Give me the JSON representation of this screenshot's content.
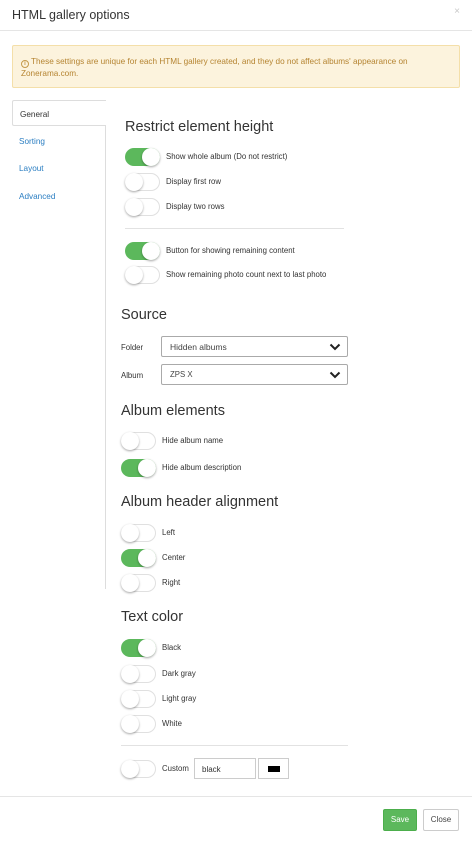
{
  "dialog": {
    "title": "HTML gallery options",
    "close_glyph": "×"
  },
  "alert": {
    "icon": "info-icon",
    "icon_glyph": "i",
    "text": "These settings are unique for each HTML gallery created, and they do not affect albums' appearance on Zonerama.com."
  },
  "tabs": [
    {
      "label": "General",
      "active": true
    },
    {
      "label": "Sorting",
      "active": false
    },
    {
      "label": "Layout",
      "active": false
    },
    {
      "label": "Advanced",
      "active": false
    }
  ],
  "restrict": {
    "title": "Restrict element height",
    "options": [
      {
        "label": "Show whole album (Do not restrict)",
        "on": true
      },
      {
        "label": "Display first row",
        "on": false
      },
      {
        "label": "Display two rows",
        "on": false
      }
    ],
    "extras": [
      {
        "label": "Button for showing remaining content",
        "on": true
      },
      {
        "label": "Show remaining photo count next to last photo",
        "on": false
      }
    ]
  },
  "source": {
    "title": "Source",
    "folder_label": "Folder",
    "folder_value": "Hidden albums",
    "album_label": "Album",
    "album_value": "ZPS X"
  },
  "album_elements": {
    "title": "Album elements",
    "options": [
      {
        "label": "Hide album name",
        "on": false
      },
      {
        "label": "Hide album description",
        "on": true
      }
    ]
  },
  "header_alignment": {
    "title": "Album header alignment",
    "options": [
      {
        "label": "Left",
        "on": false
      },
      {
        "label": "Center",
        "on": true
      },
      {
        "label": "Right",
        "on": false
      }
    ]
  },
  "text_color": {
    "title": "Text color",
    "options": [
      {
        "label": "Black",
        "on": true
      },
      {
        "label": "Dark gray",
        "on": false
      },
      {
        "label": "Light gray",
        "on": false
      },
      {
        "label": "White",
        "on": false
      }
    ],
    "custom": {
      "label": "Custom",
      "on": false,
      "value": "black",
      "swatch_color": "#000000"
    }
  },
  "footer": {
    "save_label": "Save",
    "close_label": "Close"
  },
  "colors": {
    "toggle_on": "#5cb85c",
    "link": "#2b7ec2",
    "alert_bg": "#fcf3dd",
    "alert_text": "#b58431"
  }
}
